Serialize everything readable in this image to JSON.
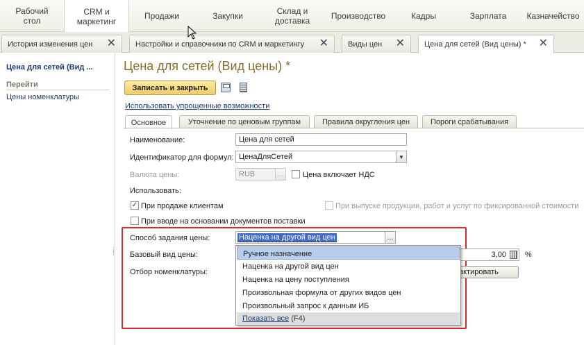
{
  "sections": [
    {
      "label": "Рабочий\nстол",
      "active": false
    },
    {
      "label": "CRM и\nмаркетинг",
      "active": true
    },
    {
      "label": "Продажи",
      "active": false
    },
    {
      "label": "Закупки",
      "active": false
    },
    {
      "label": "Склад и\nдоставка",
      "active": false
    },
    {
      "label": "Производство",
      "active": false
    },
    {
      "label": "Кадры",
      "active": false
    },
    {
      "label": "Зарплата",
      "active": false
    },
    {
      "label": "Казначейство",
      "active": false
    }
  ],
  "window_tabs": [
    {
      "label": "История изменения цен",
      "active": false
    },
    {
      "label": "Настройки и справочники по CRM и маркетингу",
      "active": false
    },
    {
      "label": "Виды цен",
      "active": false
    },
    {
      "label": "Цена для сетей (Вид цены) *",
      "active": true
    }
  ],
  "close_glyph": "✕",
  "left_panel": {
    "title": "Цена для сетей (Вид ...",
    "section_header": "Перейти",
    "links": [
      "Цены номенклатуры"
    ]
  },
  "form": {
    "title": "Цена для сетей (Вид цены) *",
    "save_close_label": "Записать и закрыть",
    "simple_mode_link": "Использовать упрощенные возможности",
    "tabs": [
      "Основное",
      "Уточнение по ценовым группам",
      "Правила округления цен",
      "Пороги срабатывания"
    ],
    "name_label": "Наименование:",
    "name_value": "Цена для сетей",
    "formula_id_label": "Идентификатор для формул:",
    "formula_id_value": "ЦенаДляСетей",
    "currency_label": "Валюта цены:",
    "currency_value": "RUB",
    "vat_label": "Цена включает НДС",
    "vat_checked": false,
    "use_label": "Использовать:",
    "sale_label": "При продаже клиентам",
    "sale_checked": true,
    "production_label": "При выпуске продукции, работ и услуг по фиксированной стоимости",
    "production_checked": false,
    "docs_label": "При вводе на основании документов поставки",
    "docs_checked": false,
    "pricing_method_label": "Способ задания цены:",
    "pricing_method_value": "Наценка на другой вид цен",
    "base_price_label": "Базовый вид цены:",
    "markup_value": "3,00",
    "percent_sign": "%",
    "filter_label": "Отбор номенклатуры:",
    "edit_button_label": "актировать"
  },
  "dropdown": {
    "items": [
      {
        "label": "Ручное назначение",
        "highlighted": true
      },
      {
        "label": "Наценка на другой вид цен",
        "highlighted": false
      },
      {
        "label": "Наценка на цену поступления",
        "highlighted": false
      },
      {
        "label": "Произвольная формула от других видов цен",
        "highlighted": false
      },
      {
        "label": "Произвольный запрос к данным ИБ",
        "highlighted": false
      }
    ],
    "show_all_link": "Показать все",
    "show_all_hotkey": " (F4)"
  },
  "colors": {
    "accent_highlight": "#d72b2b",
    "title_color": "#8a6d2a",
    "link_color": "#1a3c6e",
    "save_button": "#edcd6c"
  }
}
